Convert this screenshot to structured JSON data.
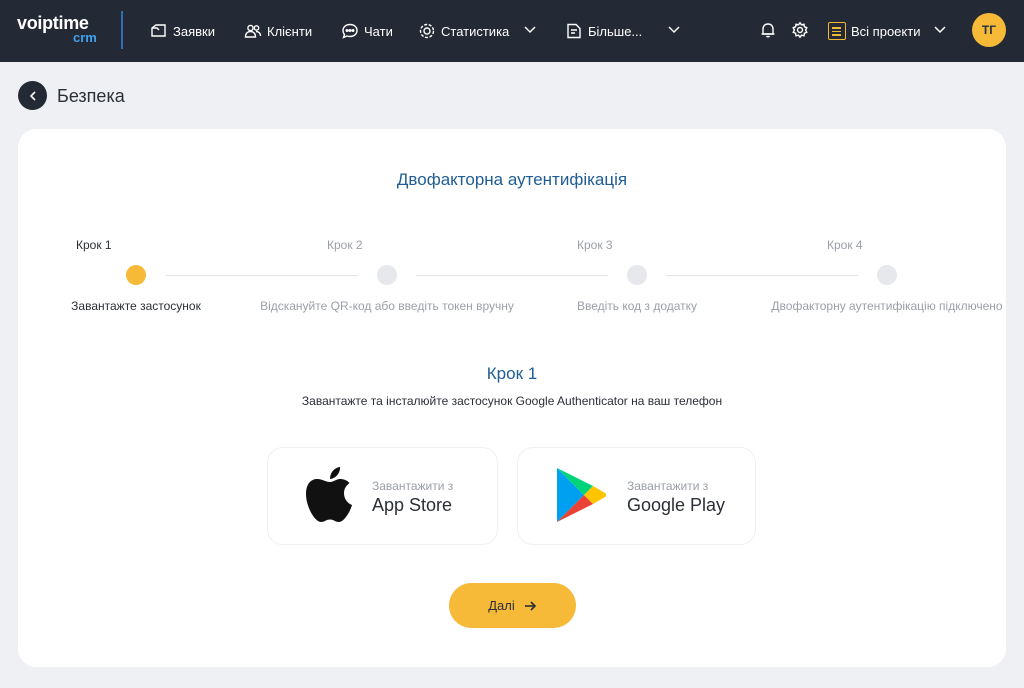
{
  "brand": {
    "logo_top": "voiptime",
    "logo_bottom": "crm"
  },
  "nav": {
    "items": [
      {
        "label": "Заявки",
        "icon": "folder-icon"
      },
      {
        "label": "Клієнти",
        "icon": "users-icon"
      },
      {
        "label": "Чати",
        "icon": "chat-icon"
      },
      {
        "label": "Статистика",
        "icon": "statistics-icon"
      },
      {
        "label": "Більше...",
        "icon": "more-icon"
      }
    ],
    "projects_label": "Всі проекти",
    "avatar_initials": "ТГ"
  },
  "page": {
    "title": "Безпека"
  },
  "card": {
    "title": "Двофакторна аутентифікація",
    "steps": [
      {
        "label": "Крок 1",
        "desc": "Завантажте застосунок",
        "active": true
      },
      {
        "label": "Крок 2",
        "desc": "Відскануйте QR-код або введіть токен вручну",
        "active": false
      },
      {
        "label": "Крок 3",
        "desc": "Введіть код з додатку",
        "active": false
      },
      {
        "label": "Крок 4",
        "desc": "Двофакторну аутентифікацію підключено",
        "active": false
      }
    ],
    "current_step_title": "Крок 1",
    "current_step_text": "Завантажте та інсталюйте застосунок Google Authenticator на ваш телефон",
    "stores": [
      {
        "small": "Завантажити з",
        "big": "App Store",
        "icon": "apple-icon"
      },
      {
        "small": "Завантажити з",
        "big": "Google Play",
        "icon": "google-play-icon"
      }
    ],
    "next_label": "Далі"
  },
  "colors": {
    "topbar": "#232a35",
    "accent": "#f6b938",
    "title_blue": "#1f5d94",
    "background": "#eef0f3"
  }
}
